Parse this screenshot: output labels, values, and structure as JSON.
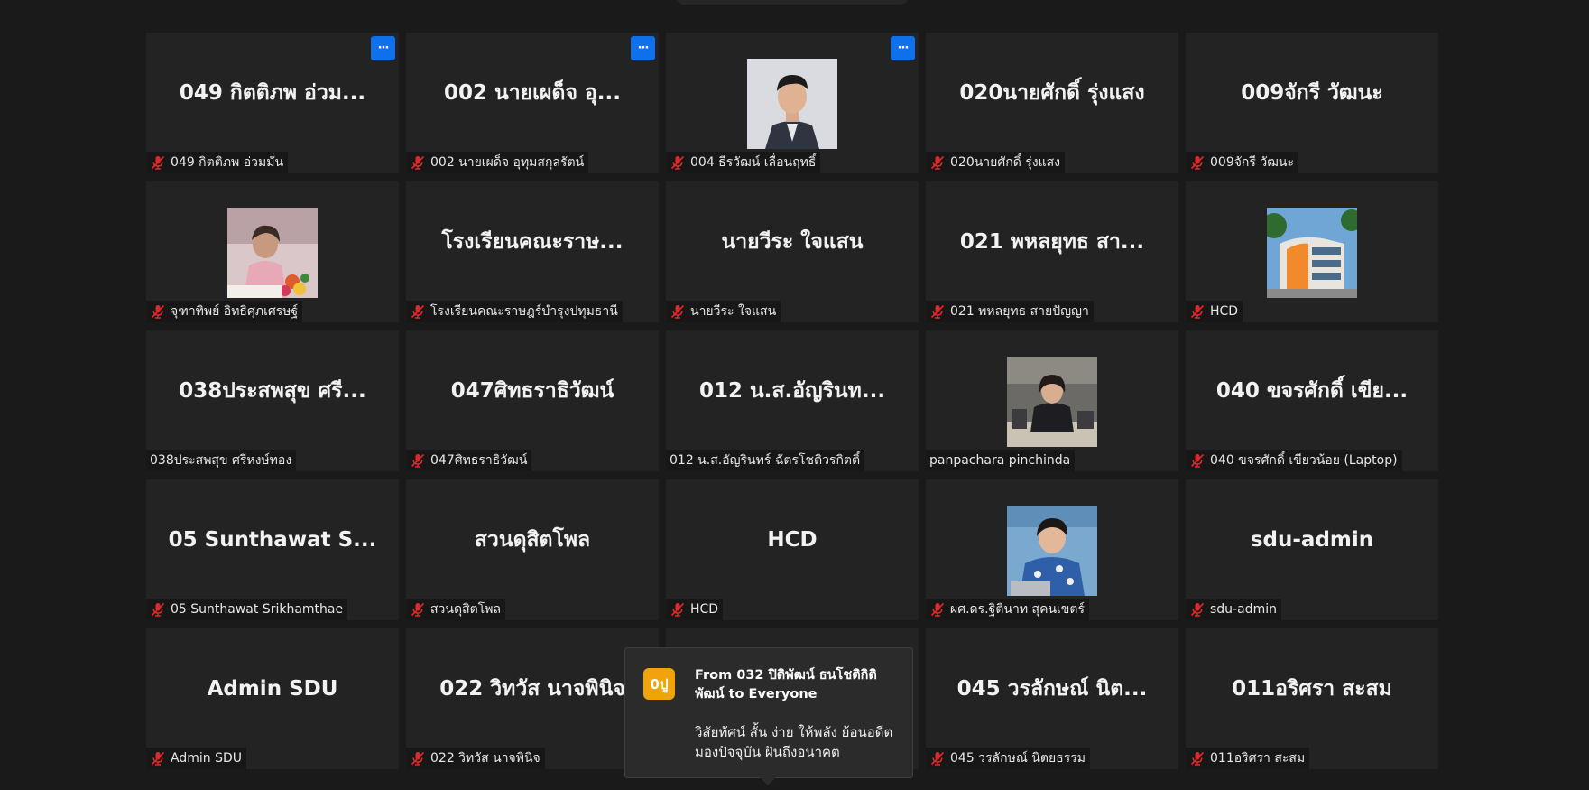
{
  "tiles": [
    {
      "big": "049 กิตติภพ อ่วม...",
      "label": "049 กิตติภพ อ่วมมั่น",
      "photo": "",
      "more": true,
      "mic": true
    },
    {
      "big": "002 นายเผด็จ  อุ...",
      "label": "002 นายเผด็จ  อุทุมสกุลรัตน์",
      "photo": "",
      "more": true,
      "mic": true
    },
    {
      "big": "",
      "label": "004 ธีรวัฒน์ เลื่อนฤทธิ์",
      "photo": "man",
      "more": true,
      "mic": true
    },
    {
      "big": "020นายศักดิ์ รุ่งแสง",
      "label": "020นายศักดิ์ รุ่งแสง",
      "photo": "",
      "more": false,
      "mic": true
    },
    {
      "big": "009จักรี  วัฒนะ",
      "label": "009จักรี  วัฒนะ",
      "photo": "",
      "more": false,
      "mic": true
    },
    {
      "big": "",
      "label": "จุฑาทิพย์ อิทธิศุภเศรษฐ์",
      "photo": "woman-flowers",
      "more": false,
      "mic": true
    },
    {
      "big": "โรงเรียนคณะราษ...",
      "label": "โรงเรียนคณะราษฎร์บำรุงปทุมธานี",
      "photo": "",
      "more": false,
      "mic": true
    },
    {
      "big": "นายวีระ ใจแสน",
      "label": "นายวีระ ใจแสน",
      "photo": "",
      "more": false,
      "mic": true
    },
    {
      "big": "021 พหลยุทธ สา...",
      "label": "021 พหลยุทธ สายปัญญา",
      "photo": "",
      "more": false,
      "mic": true
    },
    {
      "big": "",
      "label": "HCD",
      "photo": "building",
      "more": false,
      "mic": true
    },
    {
      "big": "038ประสพสุข ศรี...",
      "label": "038ประสพสุข ศรีหงษ์ทอง",
      "photo": "",
      "more": false,
      "mic": false
    },
    {
      "big": "047ศิทธราธิวัฒน์",
      "label": "047ศิทธราธิวัฒน์",
      "photo": "",
      "more": false,
      "mic": true
    },
    {
      "big": "012 น.ส.อัญรินท...",
      "label": "012 น.ส.อัญรินทร์ ฉัตรโชติวรกิตติ์",
      "photo": "",
      "more": false,
      "mic": false
    },
    {
      "big": "",
      "label": "panpachara pinchinda",
      "photo": "woman-office",
      "more": false,
      "mic": false
    },
    {
      "big": "040 ขจรศักดิ์ เขีย...",
      "label": "040 ขจรศักดิ์ เขียวน้อย (Laptop)",
      "photo": "",
      "more": false,
      "mic": true
    },
    {
      "big": "05 Sunthawat S...",
      "label": "05 Sunthawat Srikhamthae",
      "photo": "",
      "more": false,
      "mic": true
    },
    {
      "big": "สวนดุสิตโพล",
      "label": "สวนดุสิตโพล",
      "photo": "",
      "more": false,
      "mic": true
    },
    {
      "big": "HCD",
      "label": "HCD",
      "photo": "",
      "more": false,
      "mic": true
    },
    {
      "big": "",
      "label": "ผศ.ดร.ฐิตินาท สุคนเขตร์",
      "photo": "woman-laptop",
      "more": false,
      "mic": true
    },
    {
      "big": "sdu-admin",
      "label": "sdu-admin",
      "photo": "",
      "more": false,
      "mic": true
    },
    {
      "big": "Admin SDU",
      "label": "Admin SDU",
      "photo": "",
      "more": false,
      "mic": true
    },
    {
      "big": "022 วิทวัส นาจพินิจ",
      "label": "022 วิทวัส นาจพินิจ",
      "photo": "",
      "more": false,
      "mic": true
    },
    {
      "big": "",
      "label": "",
      "photo": "",
      "more": false,
      "mic": false
    },
    {
      "big": "045 วรลักษณ์ นิต...",
      "label": "045 วรลักษณ์ นิตยธรรม",
      "photo": "",
      "more": false,
      "mic": true
    },
    {
      "big": "011อริศรา สะสม",
      "label": "011อริศรา สะสม",
      "photo": "",
      "more": false,
      "mic": true
    }
  ],
  "more_button_label": "···",
  "chat": {
    "avatar": "0ปู",
    "from": "From 032 ปิติพัฒน์ ธนโชติกิติพัฒน์ to Everyone",
    "message": "วิสัยทัศน์ สั้น ง่าย ให้พลัง ย้อนอดีต มองปัจจุบัน ฝันถึงอนาคต"
  },
  "colors": {
    "background": "#1a1a1a",
    "tile": "#232323",
    "more_button": "#0e71eb",
    "muted_mic": "#e02828",
    "chat_avatar": "#f0a30a"
  }
}
